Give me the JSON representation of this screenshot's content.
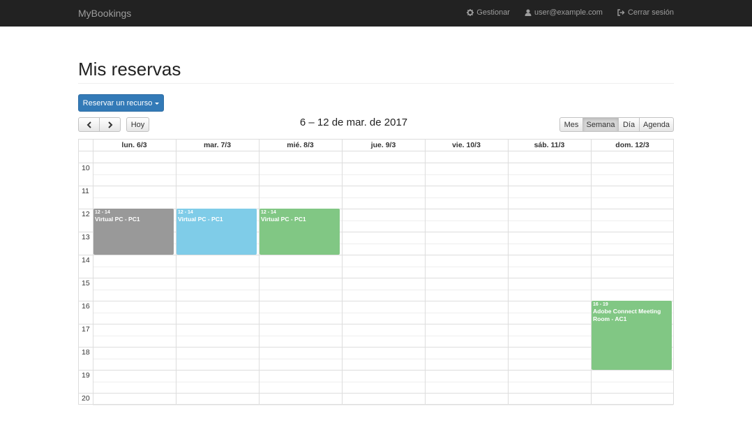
{
  "navbar": {
    "brand": "MyBookings",
    "links": [
      {
        "label": "Gestionar",
        "icon": "gear-icon"
      },
      {
        "label": "user@example.com",
        "icon": "user-icon"
      },
      {
        "label": "Cerrar sesión",
        "icon": "logout-icon"
      }
    ]
  },
  "page": {
    "title": "Mis reservas",
    "reserve_button": "Reservar un recurso"
  },
  "toolbar": {
    "prev_icon": "chevron-left-icon",
    "next_icon": "chevron-right-icon",
    "today": "Hoy",
    "title": "6 – 12 de mar. de 2017",
    "views": [
      "Mes",
      "Semana",
      "Día",
      "Agenda"
    ],
    "active_view": "Semana"
  },
  "calendar": {
    "days": [
      "lun. 6/3",
      "mar. 7/3",
      "mié. 8/3",
      "jue. 9/3",
      "vie. 10/3",
      "sáb. 11/3",
      "dom. 12/3"
    ],
    "hours": [
      "10",
      "11",
      "12",
      "13",
      "14",
      "15",
      "16",
      "17",
      "18",
      "19",
      "20"
    ],
    "events": [
      {
        "day": 0,
        "start": 12,
        "end": 14,
        "time": "12 - 14",
        "title": "Virtual PC - PC1",
        "color": "#999999"
      },
      {
        "day": 1,
        "start": 12,
        "end": 14,
        "time": "12 - 14",
        "title": "Virtual PC - PC1",
        "color": "#7fcce8"
      },
      {
        "day": 2,
        "start": 12,
        "end": 14,
        "time": "12 - 14",
        "title": "Virtual PC - PC1",
        "color": "#81c784"
      },
      {
        "day": 6,
        "start": 16,
        "end": 19,
        "time": "16 - 19",
        "title": "Adobe Connect Meeting Room - AC1",
        "color": "#81c784"
      }
    ]
  },
  "colors": {
    "navbar_bg": "#222222",
    "primary": "#337ab7"
  }
}
